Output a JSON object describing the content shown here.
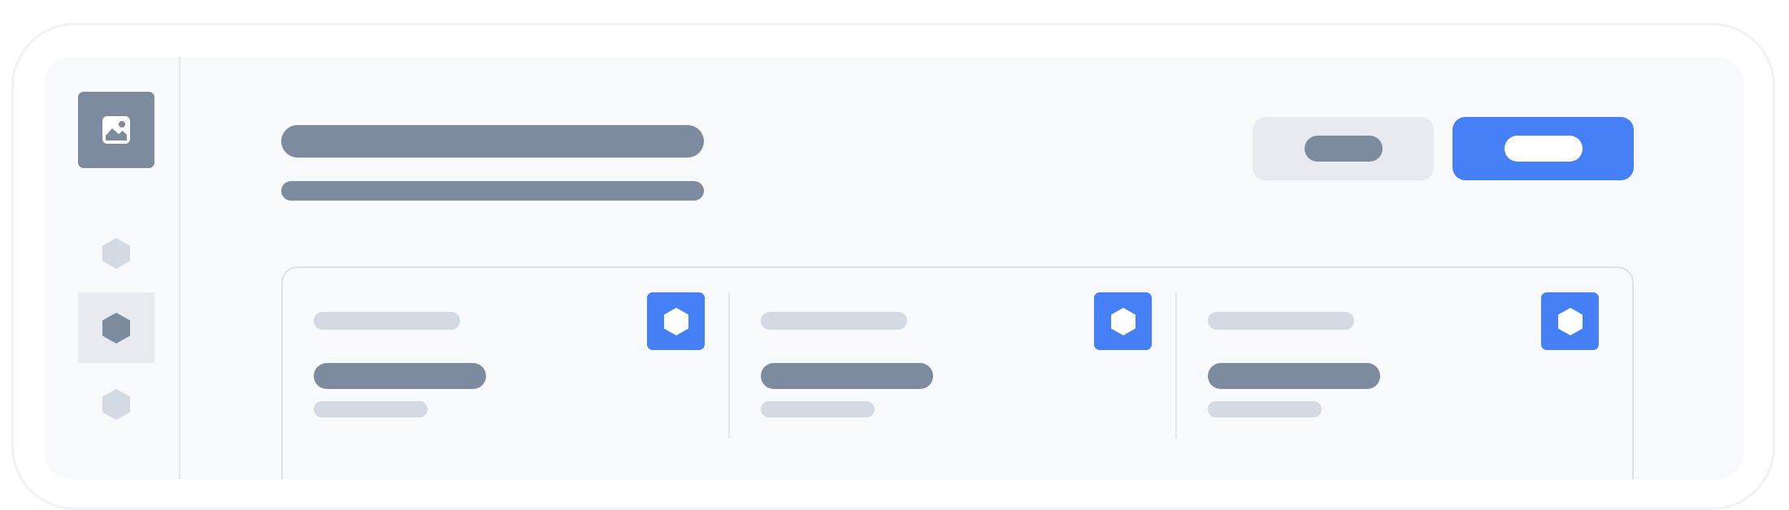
{
  "colors": {
    "accent": "#4680f6",
    "placeholder_dark": "#7d8b9e",
    "placeholder_light": "#d4dae3",
    "surface": "#f8f9fb",
    "active_nav": "#e8eaef"
  },
  "sidebar": {
    "logo_icon": "image-icon",
    "items": [
      {
        "icon": "hexagon-icon",
        "active": false
      },
      {
        "icon": "hexagon-icon",
        "active": true
      },
      {
        "icon": "hexagon-icon",
        "active": false
      }
    ]
  },
  "header": {
    "title": "",
    "subtitle": "",
    "secondary_action_label": "",
    "primary_action_label": ""
  },
  "stats": [
    {
      "label": "",
      "value": "",
      "sub": "",
      "icon": "hexagon-icon"
    },
    {
      "label": "",
      "value": "",
      "sub": "",
      "icon": "hexagon-icon"
    },
    {
      "label": "",
      "value": "",
      "sub": "",
      "icon": "hexagon-icon"
    }
  ]
}
